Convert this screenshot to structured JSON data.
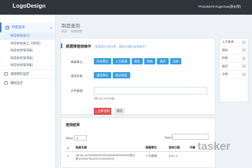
{
  "topbar": {
    "logo": "LogoDesign",
    "user": "TP2045878 RogerXue(薛永傑)"
  },
  "sidebar": {
    "section": "制度查詢",
    "items": [
      {
        "label": "制度查詢(員工)",
        "active": true
      },
      {
        "label": "制度查詢(員工_印度版)",
        "active": false
      },
      {
        "label": "制度查詢(管理員)",
        "active": false
      },
      {
        "label": "制度查詢(管理員)",
        "active": false
      },
      {
        "label": "制度查詢(管理員)",
        "active": false
      }
    ],
    "groups": [
      {
        "label": "基礎資料設定"
      },
      {
        "label": "權限設定"
      }
    ]
  },
  "main": {
    "title": "制度查詢",
    "breadcrumb": [
      "首頁",
      "制度查詢"
    ],
    "filter": {
      "title": "請選擇查詢條件",
      "hint": "(查看請在項目裡，選取對應的查詢條件)",
      "dept_label": "歸屬單位：",
      "dept_chips": [
        "所有單位",
        "人力資源",
        "環安",
        "財務",
        "資訊",
        "法務"
      ],
      "type_label": "適用對象：",
      "type_chips": [
        "適用單位",
        "歷史制度"
      ],
      "file_label": "文件編號：",
      "file_hint": "(例:GA-00190或)",
      "search_btn": "立即查詢",
      "clear_btn": "清除"
    },
    "results": {
      "title": "查詢結果",
      "show_label": "Show",
      "show_value": "5",
      "search_label": "Search:",
      "columns": [
        "#",
        "制度名稱",
        "歸屬單位",
        "發佈日期",
        "作業"
      ],
      "rows": [
        {
          "no": "1",
          "name": "QB-AA-0100000000000000000000000000000(對比號:v20040701)(20071226103313)",
          "dept": "人力資源",
          "date": "2017-1..."
        }
      ]
    }
  },
  "right_panel": {
    "items": [
      {
        "label": "人力資源"
      },
      {
        "label": "環安"
      },
      {
        "label": "財務"
      },
      {
        "label": "資訊"
      },
      {
        "label": "法務"
      }
    ]
  },
  "watermark": "tasker"
}
